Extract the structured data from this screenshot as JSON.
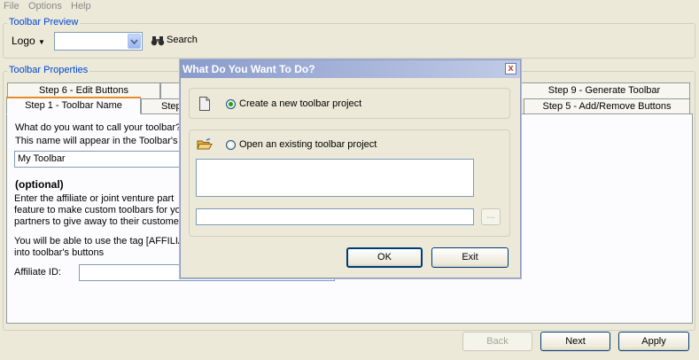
{
  "menubar": {
    "file": "File",
    "options": "Options",
    "help": "Help"
  },
  "toolbar_preview": {
    "title": "Toolbar Preview",
    "logo_label": "Logo",
    "combo_value": "",
    "search_label": "Search"
  },
  "toolbar_properties": {
    "title": "Toolbar Properties",
    "tabs_back": [
      "Step 6 - Edit Buttons",
      "Step 9 - Generate Toolbar"
    ],
    "tabs_front": [
      "Step 1 - Toolbar Name",
      "Step",
      "Step 5 - Add/Remove Buttons"
    ],
    "question": "What do you want to call your toolbar?",
    "name_note": "This name will appear in the Toolbar's in",
    "name_value": "My Toolbar",
    "optional_heading": "(optional)",
    "affiliate_desc_1": "Enter the affiliate or joint venture part",
    "affiliate_desc_2": "feature to make custom toolbars for yo",
    "affiliate_desc_3": "partners to give away to their custome",
    "tag_desc_1": "You will be able to use the tag [AFFILIA",
    "tag_desc_2": "into toolbar's buttons",
    "affiliate_label": "Affiliate ID:",
    "affiliate_value": ""
  },
  "wizard_buttons": {
    "back": "Back",
    "next": "Next",
    "apply": "Apply"
  },
  "dialog": {
    "title": "What Do You Want To Do?",
    "close": "x",
    "option_new": "Create a new toolbar project",
    "option_open": "Open an existing toolbar project",
    "path_value": "",
    "browse": "...",
    "ok": "OK",
    "exit": "Exit"
  },
  "colors": {
    "accent": "#0046d5",
    "window": "#ece9d8",
    "dialog_title": "#8a9bcc"
  }
}
